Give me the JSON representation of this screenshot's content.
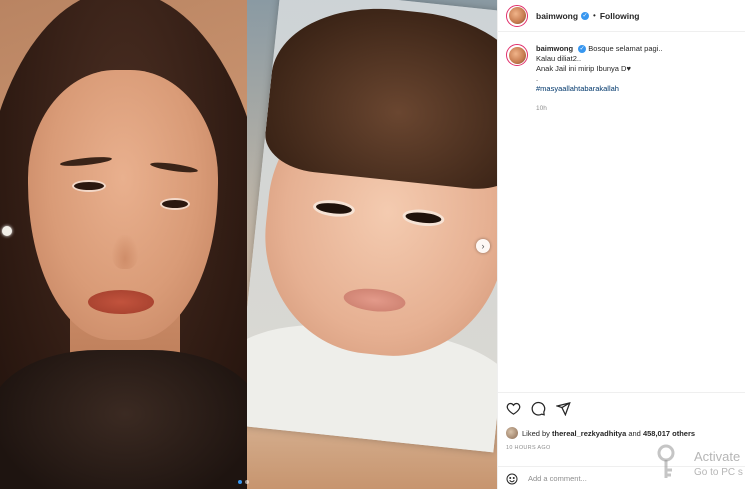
{
  "post": {
    "username": "baimwong",
    "separator": "•",
    "follow_state": "Following",
    "verified_mark": "✓"
  },
  "caption": {
    "username": "baimwong",
    "line1": "Bosque selamat pagi..",
    "line2": "Kalau diliat2..",
    "line3": "Anak Jail ini mirip Ibunya D♥",
    "line4": ".",
    "hashtag": "#masyaallahtabarakallah",
    "age": "10h"
  },
  "carousel": {
    "next_glyph": "›",
    "dot_count": 2,
    "active_index": 0
  },
  "engagement": {
    "liked_by_prefix": "Liked by",
    "liked_by_user": "thereal_rezkyadhitya",
    "and_text": "and",
    "others_count": "458,017 others",
    "timestamp": "10 HOURS AGO"
  },
  "comment": {
    "placeholder": "Add a comment..."
  },
  "watermark": {
    "line1": "Activate",
    "line2": "Go to PC s"
  },
  "icons": {
    "like": "heart-icon",
    "comment": "comment-icon",
    "share": "share-icon",
    "emoji": "emoji-icon",
    "verified": "verified-badge-icon"
  },
  "colors": {
    "accent_blue": "#3897f0",
    "hashtag": "#00376b",
    "secondary_text": "#8e8e8e",
    "divider": "#efefef",
    "story_ring": "#e1306c"
  }
}
